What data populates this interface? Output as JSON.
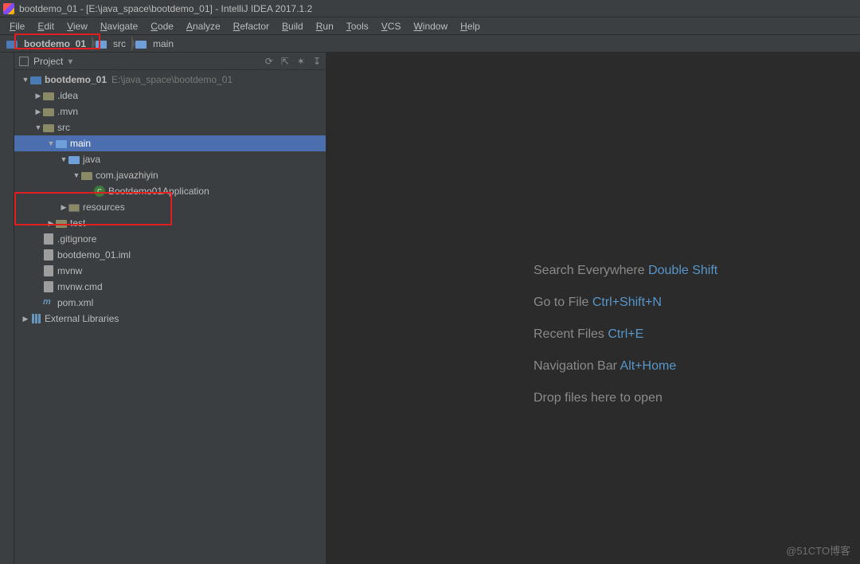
{
  "title": "bootdemo_01 - [E:\\java_space\\bootdemo_01] - IntelliJ IDEA 2017.1.2",
  "menu": [
    "File",
    "Edit",
    "View",
    "Navigate",
    "Code",
    "Analyze",
    "Refactor",
    "Build",
    "Run",
    "Tools",
    "VCS",
    "Window",
    "Help"
  ],
  "breadcrumbs": [
    "bootdemo_01",
    "src",
    "main"
  ],
  "toolwindow": {
    "title": "Project",
    "dropdown": "▾",
    "actions": [
      "⟳",
      "⇱",
      "✶",
      "↧"
    ]
  },
  "tree": [
    {
      "depth": 0,
      "arrow": "down",
      "icon": "folder-blue",
      "label": "bootdemo_01",
      "bold": true,
      "path": "E:\\java_space\\bootdemo_01"
    },
    {
      "depth": 1,
      "arrow": "right",
      "icon": "folder",
      "label": ".idea"
    },
    {
      "depth": 1,
      "arrow": "right",
      "icon": "folder",
      "label": ".mvn"
    },
    {
      "depth": 1,
      "arrow": "down",
      "icon": "folder",
      "label": "src"
    },
    {
      "depth": 2,
      "arrow": "down",
      "icon": "folder-src",
      "label": "main",
      "selected": true
    },
    {
      "depth": 3,
      "arrow": "down",
      "icon": "folder-src",
      "label": "java"
    },
    {
      "depth": 4,
      "arrow": "down",
      "icon": "folder",
      "label": "com.javazhiyin"
    },
    {
      "depth": 5,
      "arrow": "none",
      "icon": "class",
      "label": "Bootdemo01Application"
    },
    {
      "depth": 3,
      "arrow": "right",
      "icon": "folder-res",
      "label": "resources"
    },
    {
      "depth": 2,
      "arrow": "right",
      "icon": "folder",
      "label": "test"
    },
    {
      "depth": 1,
      "arrow": "none",
      "icon": "file",
      "label": ".gitignore"
    },
    {
      "depth": 1,
      "arrow": "none",
      "icon": "file",
      "label": "bootdemo_01.iml"
    },
    {
      "depth": 1,
      "arrow": "none",
      "icon": "file",
      "label": "mvnw"
    },
    {
      "depth": 1,
      "arrow": "none",
      "icon": "file",
      "label": "mvnw.cmd"
    },
    {
      "depth": 1,
      "arrow": "none",
      "icon": "xml",
      "label": "pom.xml"
    },
    {
      "depth": 0,
      "arrow": "right",
      "icon": "lib",
      "label": "External Libraries"
    }
  ],
  "hints": [
    {
      "label": "Search Everywhere",
      "key": "Double Shift"
    },
    {
      "label": "Go to File",
      "key": "Ctrl+Shift+N"
    },
    {
      "label": "Recent Files",
      "key": "Ctrl+E"
    },
    {
      "label": "Navigation Bar",
      "key": "Alt+Home"
    },
    {
      "label": "Drop files here to open",
      "key": ""
    }
  ],
  "watermark": "@51CTO博客"
}
